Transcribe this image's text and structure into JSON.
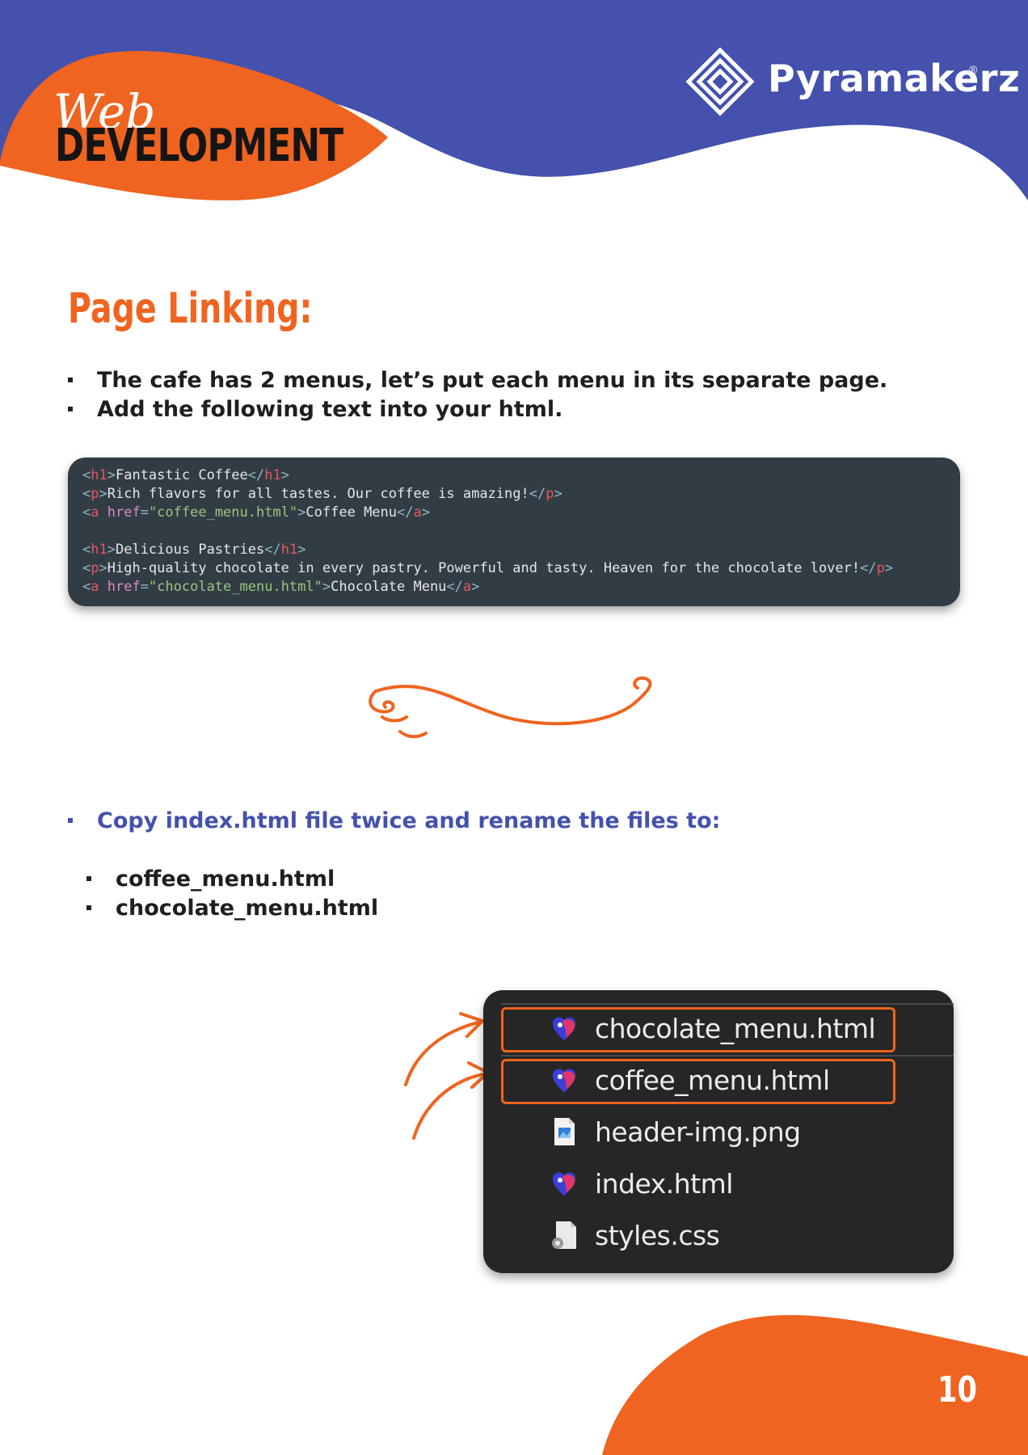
{
  "brand": {
    "name": "Pyramakerz",
    "registered": "®"
  },
  "badge": {
    "script": "Web",
    "main": "DEVELOPMENT"
  },
  "title": "Page Linking:",
  "intro_bullets": [
    "The cafe has 2 menus, let’s put each menu in its separate page.",
    "Add the following text into your html."
  ],
  "code": {
    "lines": [
      [
        {
          "t": "<",
          "c": "br"
        },
        {
          "t": "h1",
          "c": "tag"
        },
        {
          "t": ">",
          "c": "br"
        },
        {
          "t": "Fantastic Coffee",
          "c": "txt"
        },
        {
          "t": "</",
          "c": "br"
        },
        {
          "t": "h1",
          "c": "tag"
        },
        {
          "t": ">",
          "c": "br"
        }
      ],
      [
        {
          "t": "<",
          "c": "br"
        },
        {
          "t": "p",
          "c": "tag"
        },
        {
          "t": ">",
          "c": "br"
        },
        {
          "t": "Rich flavors for all tastes. Our coffee is amazing!",
          "c": "txt"
        },
        {
          "t": "</",
          "c": "br"
        },
        {
          "t": "p",
          "c": "tag"
        },
        {
          "t": ">",
          "c": "br"
        }
      ],
      [
        {
          "t": "<",
          "c": "br"
        },
        {
          "t": "a",
          "c": "tag"
        },
        {
          "t": " href",
          "c": "attr"
        },
        {
          "t": "=",
          "c": "br"
        },
        {
          "t": "\"coffee_menu.html\"",
          "c": "str"
        },
        {
          "t": ">",
          "c": "br"
        },
        {
          "t": "Coffee Menu",
          "c": "txt"
        },
        {
          "t": "</",
          "c": "br"
        },
        {
          "t": "a",
          "c": "tag"
        },
        {
          "t": ">",
          "c": "br"
        }
      ],
      [],
      [
        {
          "t": "<",
          "c": "br"
        },
        {
          "t": "h1",
          "c": "tag"
        },
        {
          "t": ">",
          "c": "br"
        },
        {
          "t": "Delicious Pastries",
          "c": "txt"
        },
        {
          "t": "</",
          "c": "br"
        },
        {
          "t": "h1",
          "c": "tag"
        },
        {
          "t": ">",
          "c": "br"
        }
      ],
      [
        {
          "t": "<",
          "c": "br"
        },
        {
          "t": "p",
          "c": "tag"
        },
        {
          "t": ">",
          "c": "br"
        },
        {
          "t": "High-quality chocolate in every pastry. Powerful and tasty. Heaven for the chocolate lover!",
          "c": "txt"
        },
        {
          "t": "</",
          "c": "br"
        },
        {
          "t": "p",
          "c": "tag"
        },
        {
          "t": ">",
          "c": "br"
        }
      ],
      [
        {
          "t": "<",
          "c": "br"
        },
        {
          "t": "a",
          "c": "tag"
        },
        {
          "t": " href",
          "c": "attr"
        },
        {
          "t": "=",
          "c": "br"
        },
        {
          "t": "\"chocolate_menu.html\"",
          "c": "str"
        },
        {
          "t": ">",
          "c": "br"
        },
        {
          "t": "Chocolate Menu",
          "c": "txt"
        },
        {
          "t": "</",
          "c": "br"
        },
        {
          "t": "a",
          "c": "tag"
        },
        {
          "t": ">",
          "c": "br"
        }
      ]
    ]
  },
  "copy_instruction": "Copy index.html file twice and rename the files to:",
  "new_files": [
    "coffee_menu.html",
    "chocolate_menu.html"
  ],
  "file_list": [
    {
      "name": "chocolate_menu.html",
      "icon": "html-file-icon",
      "highlighted": true
    },
    {
      "name": "coffee_menu.html",
      "icon": "html-file-icon",
      "highlighted": true
    },
    {
      "name": "header-img.png",
      "icon": "image-file-icon",
      "highlighted": false
    },
    {
      "name": "index.html",
      "icon": "html-file-icon",
      "highlighted": false
    },
    {
      "name": "styles.css",
      "icon": "css-file-icon",
      "highlighted": false
    }
  ],
  "page_number": "10",
  "colors": {
    "blue": "#4451ad",
    "orange": "#ef6420",
    "dark": "#1f1f1f",
    "code_bg": "#323c45"
  }
}
